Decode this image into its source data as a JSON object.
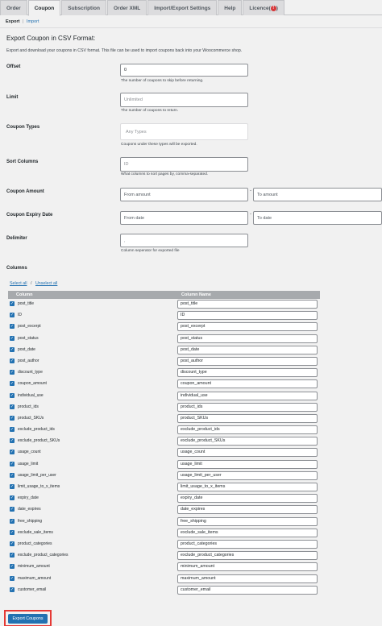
{
  "tabs": [
    {
      "label": "Order"
    },
    {
      "label": "Coupon"
    },
    {
      "label": "Subscription"
    },
    {
      "label": "Order XML"
    },
    {
      "label": "Import/Export Settings"
    },
    {
      "label": "Help"
    },
    {
      "label": "Licence",
      "badge": "!"
    }
  ],
  "active_tab": "Coupon",
  "subnav": {
    "current": "Export",
    "separator": "|",
    "link": "Import"
  },
  "heading": "Export Coupon in CSV Format:",
  "description": "Export and download your coupons in CSV format. This file can be used to import coupons back into your Woocommerce shop.",
  "fields": {
    "offset": {
      "label": "Offset",
      "value": "0",
      "hint": "The number of coupons to skip before returning."
    },
    "limit": {
      "label": "Limit",
      "placeholder": "Unlimited",
      "hint": "The number of coupons to return."
    },
    "coupon_types": {
      "label": "Coupon Types",
      "placeholder": "Any Types",
      "hint": "Coupons under these types will be exported."
    },
    "sort_columns": {
      "label": "Sort Columns",
      "value": "ID",
      "hint": "What columns to sort pages by, comma-separated."
    },
    "coupon_amount": {
      "label": "Coupon Amount",
      "from_placeholder": "From amount",
      "separator": "-",
      "to_placeholder": "To amount"
    },
    "coupon_expiry_date": {
      "label": "Coupon Expiry Date",
      "from_placeholder": "From date",
      "separator": "-",
      "to_placeholder": "To date"
    },
    "delimiter": {
      "label": "Delimiter",
      "value": ",",
      "hint": "Column seperator for exported file"
    }
  },
  "columns_section": {
    "label": "Columns",
    "select_all": "Select all",
    "separator": "/",
    "unselect_all": "Unselect all",
    "header_column": "Column",
    "header_column_name": "Column Name"
  },
  "columns": [
    {
      "column": "post_title",
      "name": "post_title",
      "checked": true
    },
    {
      "column": "ID",
      "name": "ID",
      "checked": true
    },
    {
      "column": "post_excerpt",
      "name": "post_excerpt",
      "checked": true
    },
    {
      "column": "post_status",
      "name": "post_status",
      "checked": true
    },
    {
      "column": "post_date",
      "name": "post_date",
      "checked": true
    },
    {
      "column": "post_author",
      "name": "post_author",
      "checked": true
    },
    {
      "column": "discount_type",
      "name": "discount_type",
      "checked": true
    },
    {
      "column": "coupon_amount",
      "name": "coupon_amount",
      "checked": true
    },
    {
      "column": "individual_use",
      "name": "individual_use",
      "checked": true
    },
    {
      "column": "product_ids",
      "name": "product_ids",
      "checked": true
    },
    {
      "column": "product_SKUs",
      "name": "product_SKUs",
      "checked": true
    },
    {
      "column": "exclude_product_ids",
      "name": "exclude_product_ids",
      "checked": true
    },
    {
      "column": "exclude_product_SKUs",
      "name": "exclude_product_SKUs",
      "checked": true
    },
    {
      "column": "usage_count",
      "name": "usage_count",
      "checked": true
    },
    {
      "column": "usage_limit",
      "name": "usage_limit",
      "checked": true
    },
    {
      "column": "usage_limit_per_user",
      "name": "usage_limit_per_user",
      "checked": true
    },
    {
      "column": "limit_usage_to_x_items",
      "name": "limit_usage_to_x_items",
      "checked": true
    },
    {
      "column": "expiry_date",
      "name": "expiry_date",
      "checked": true
    },
    {
      "column": "date_expires",
      "name": "date_expires",
      "checked": true
    },
    {
      "column": "free_shipping",
      "name": "free_shipping",
      "checked": true
    },
    {
      "column": "exclude_sale_items",
      "name": "exclude_sale_items",
      "checked": true
    },
    {
      "column": "product_categories",
      "name": "product_categories",
      "checked": true
    },
    {
      "column": "exclude_product_categories",
      "name": "exclude_product_categories",
      "checked": true
    },
    {
      "column": "minimum_amount",
      "name": "minimum_amount",
      "checked": true
    },
    {
      "column": "maximum_amount",
      "name": "maximum_amount",
      "checked": true
    },
    {
      "column": "customer_email",
      "name": "customer_email",
      "checked": true
    }
  ],
  "export_button": "Export Coupons",
  "colors": {
    "primary": "#2271b1",
    "highlight_border": "#e53935",
    "table_header": "#a7aaad"
  }
}
